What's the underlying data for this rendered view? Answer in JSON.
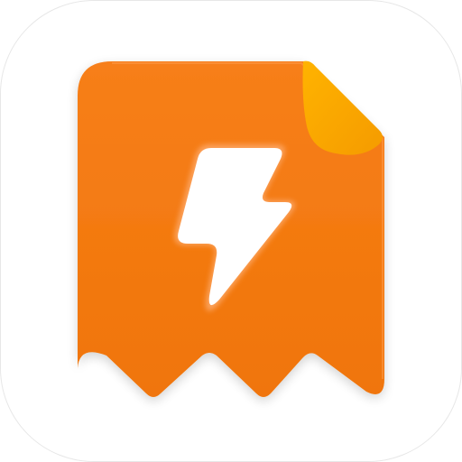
{
  "app_icon": {
    "icon": "bolt-receipt-icon",
    "colors": {
      "tile_background": "#ffffff",
      "tile_border": "#e7e7e7",
      "document_top": "#f77f1a",
      "document_bottom": "#f07508",
      "document_edge_highlight": "#ff9a4a",
      "corner_fold_light": "#ffb300",
      "corner_fold_dark": "#f59b00",
      "bolt_fill": "#ffffff",
      "bolt_glow": "#ffb27a"
    }
  }
}
